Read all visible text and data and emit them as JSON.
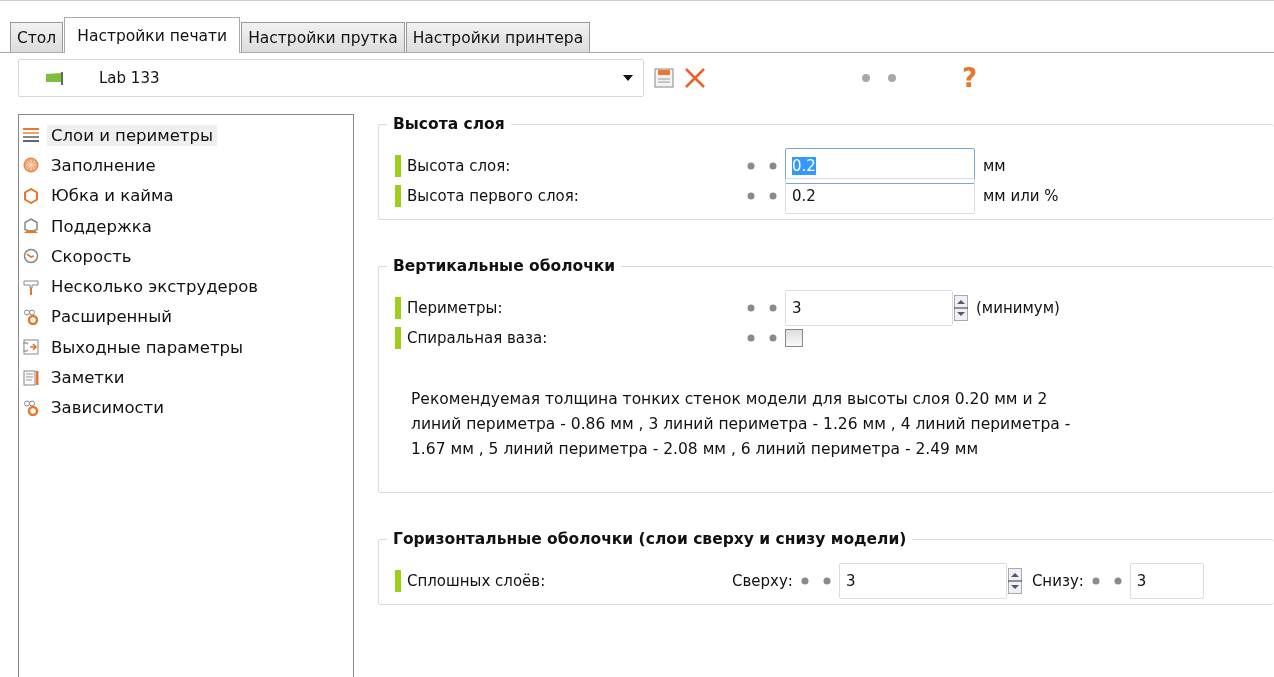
{
  "tabs": [
    {
      "label": "Стол",
      "selected": false
    },
    {
      "label": "Настройки печати",
      "selected": true
    },
    {
      "label": "Настройки прутка",
      "selected": false
    },
    {
      "label": "Настройки принтера",
      "selected": false
    }
  ],
  "preset": {
    "value": "Lab 133"
  },
  "help": "?",
  "sidebar": {
    "items": [
      {
        "label": "Слои и периметры",
        "selected": true
      },
      {
        "label": "Заполнение",
        "selected": false
      },
      {
        "label": "Юбка и кайма",
        "selected": false
      },
      {
        "label": "Поддержка",
        "selected": false
      },
      {
        "label": "Скорость",
        "selected": false
      },
      {
        "label": "Несколько экструдеров",
        "selected": false
      },
      {
        "label": "Расширенный",
        "selected": false
      },
      {
        "label": "Выходные параметры",
        "selected": false
      },
      {
        "label": "Заметки",
        "selected": false
      },
      {
        "label": "Зависимости",
        "selected": false
      }
    ]
  },
  "sections": [
    {
      "title": "Высота слоя",
      "rows": [
        {
          "kind": "text",
          "label": "Высота слоя:",
          "value": "0.2",
          "value_selected": true,
          "unit": "мм"
        },
        {
          "kind": "text",
          "label": "Высота первого слоя:",
          "value": "0.2",
          "value_selected": false,
          "unit": "мм или %"
        }
      ]
    },
    {
      "title": "Вертикальные оболочки",
      "rows": [
        {
          "kind": "spin",
          "label": "Периметры:",
          "value": "3",
          "unit": "(минимум)"
        },
        {
          "kind": "checkbox",
          "label": "Спиральная ваза:",
          "checked": false
        }
      ],
      "note": "Рекомендуемая толщина тонких стенок модели для высоты слоя 0.20 мм и 2 линий периметра - 0.86 мм , 3 линий периметра - 1.26 мм , 4 линий периметра - 1.67 мм , 5 линий периметра - 2.08 мм , 6 линий периметра - 2.49 мм"
    },
    {
      "title": "Горизонтальные оболочки (слои сверху и снизу модели)",
      "rows": [
        {
          "kind": "split",
          "label": "Сплошных слоёв:",
          "top_label": "Сверху:",
          "top_value": "3",
          "bottom_label": "Снизу:",
          "bottom_value": "3"
        }
      ]
    }
  ]
}
